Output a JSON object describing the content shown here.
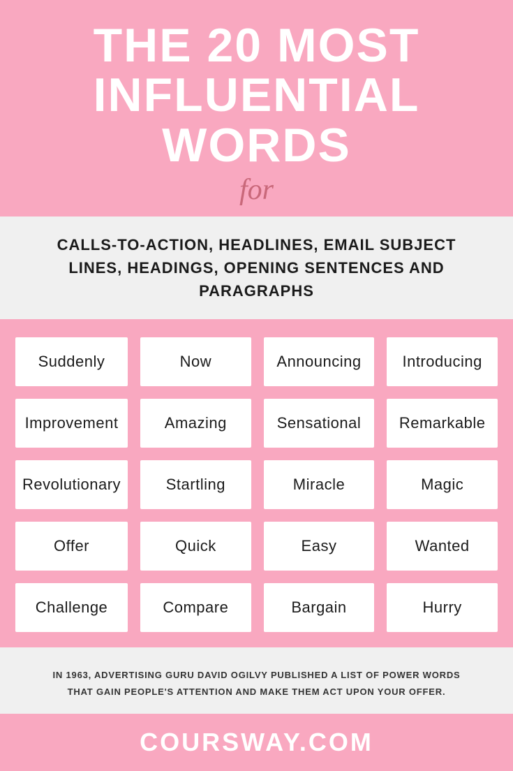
{
  "header": {
    "main_title_line1": "THE 20 MOST",
    "main_title_line2": "INFLUENTIAL WORDS",
    "for_label": "for",
    "subtitle": "CALLS-TO-ACTION, HEADLINES, EMAIL SUBJECT LINES, HEADINGS, OPENING SENTENCES AND PARAGRAPHS"
  },
  "grid": {
    "words": [
      "Suddenly",
      "Now",
      "Announcing",
      "Introducing",
      "Improvement",
      "Amazing",
      "Sensational",
      "Remarkable",
      "Revolutionary",
      "Startling",
      "Miracle",
      "Magic",
      "Offer",
      "Quick",
      "Easy",
      "Wanted",
      "Challenge",
      "Compare",
      "Bargain",
      "Hurry"
    ]
  },
  "footer": {
    "description": "IN 1963, ADVERTISING GURU DAVID OGILVY PUBLISHED A LIST OF POWER WORDS THAT GAIN PEOPLE'S ATTENTION AND MAKE THEM ACT UPON YOUR OFFER."
  },
  "brand": {
    "name": "COURSWAY.COM"
  }
}
